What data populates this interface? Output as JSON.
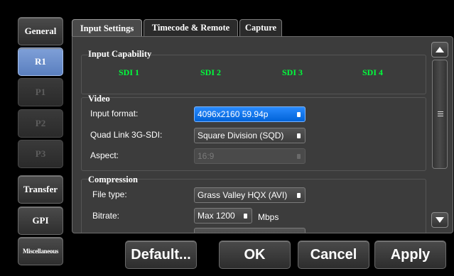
{
  "nav": [
    {
      "label": "General",
      "state": "normal"
    },
    {
      "label": "R1",
      "state": "active"
    },
    {
      "label": "P1",
      "state": "disabled"
    },
    {
      "label": "P2",
      "state": "disabled"
    },
    {
      "label": "P3",
      "state": "disabled"
    },
    {
      "label": "Transfer",
      "state": "normal"
    },
    {
      "label": "GPI",
      "state": "normal"
    },
    {
      "label": "Miscellaneous",
      "state": "normal"
    }
  ],
  "tabs": [
    "Input Settings",
    "Timecode & Remote",
    "Capture"
  ],
  "input_capability": {
    "title": "Input Capability",
    "channels": [
      "SDI 1",
      "SDI 2",
      "SDI 3",
      "SDI 4"
    ],
    "channel_color": "#00ff3c"
  },
  "video": {
    "title": "Video",
    "input_format_label": "Input format:",
    "input_format_value": "4096x2160 59.94p",
    "quad_link_label": "Quad Link 3G-SDI:",
    "quad_link_value": "Square Division (SQD)",
    "aspect_label": "Aspect:",
    "aspect_value": "16:9"
  },
  "compression": {
    "title": "Compression",
    "file_type_label": "File type:",
    "file_type_value": "Grass Valley HQX (AVI)",
    "bitrate_label": "Bitrate:",
    "bitrate_value": "Max 1200",
    "bitrate_unit": "Mbps"
  },
  "buttons": {
    "default": "Default...",
    "ok": "OK",
    "cancel": "Cancel",
    "apply": "Apply"
  },
  "colors": {
    "accent_blue": "#0063d8",
    "active_nav": "#6a8fcc"
  }
}
